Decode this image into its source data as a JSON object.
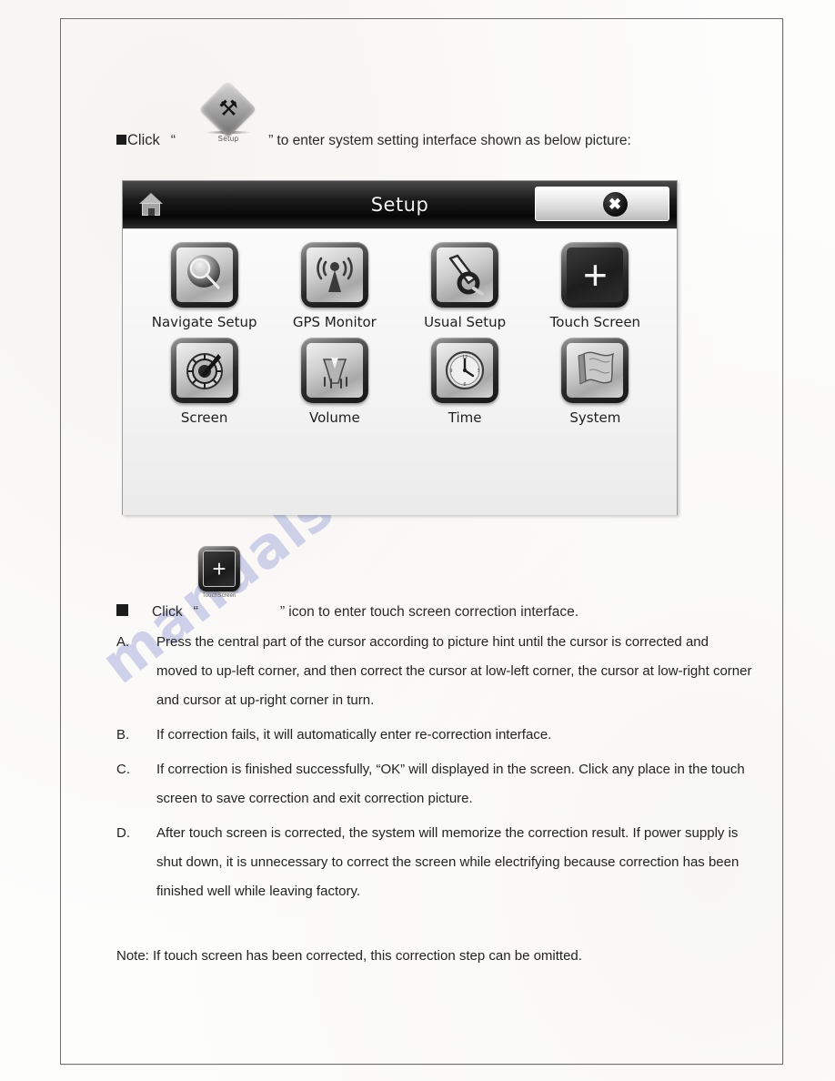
{
  "page": {
    "watermark": "manualshive.com"
  },
  "intro": {
    "bullet": "■",
    "click_word": "Click",
    "open_quote": "“",
    "close_quote": "”",
    "icon_label": "Setup",
    "icon_name": "setup-tools-diamond",
    "rest_text": "to enter system setting interface shown as below picture:"
  },
  "device": {
    "title": "Setup",
    "home_icon": "home-icon",
    "close_icon": "✖",
    "rows": [
      {
        "items": [
          {
            "label": "Navigate Setup",
            "icon": "magnifier-icon",
            "glyph": "⌕",
            "dark": false
          },
          {
            "label": "GPS Monitor",
            "icon": "antenna-signal-icon",
            "glyph": "὎1",
            "dark": false
          },
          {
            "label": "Usual Setup",
            "icon": "wrench-icon",
            "glyph": "ὒ7",
            "dark": false
          },
          {
            "label": "Touch Screen",
            "icon": "crosshair-plus-icon",
            "glyph": "+",
            "dark": true
          }
        ]
      },
      {
        "items": [
          {
            "label": "Screen",
            "icon": "brightness-dial-icon",
            "glyph": "☀",
            "dark": false
          },
          {
            "label": "Volume",
            "icon": "speaker-icon",
            "glyph": "ὐA",
            "dark": false
          },
          {
            "label": "Time",
            "icon": "clock-icon",
            "glyph": "ὕ1",
            "dark": false
          },
          {
            "label": "System",
            "icon": "flag-icon",
            "glyph": "⚑",
            "dark": false
          }
        ]
      }
    ]
  },
  "touch_section": {
    "bullet": "■",
    "click_word": "Click",
    "open_quote": "“",
    "close_quote": "”",
    "icon_label": "TouchScreen",
    "icon_glyph": "+",
    "rest_text": "icon to enter touch screen correction interface.",
    "steps": [
      {
        "letter": "A.",
        "text": "Press the central part of the cursor according to picture hint until the cursor is corrected and moved to up-left corner, and then correct the cursor at low-left corner, the cursor at low-right corner and cursor at up-right corner in turn."
      },
      {
        "letter": "B.",
        "text": "If correction fails, it will automatically enter re-correction interface."
      },
      {
        "letter": "C.",
        "text": "If correction is finished successfully, “OK” will displayed in the screen. Click any place in the touch screen to save correction and exit correction picture."
      },
      {
        "letter": "D.",
        "text": "After touch screen is corrected, the system will memorize the correction result. If power supply is shut down, it is unnecessary to correct the screen while electrifying because correction has been finished well while leaving factory."
      }
    ],
    "note": "Note: If touch screen has been corrected, this correction step can be omitted."
  }
}
